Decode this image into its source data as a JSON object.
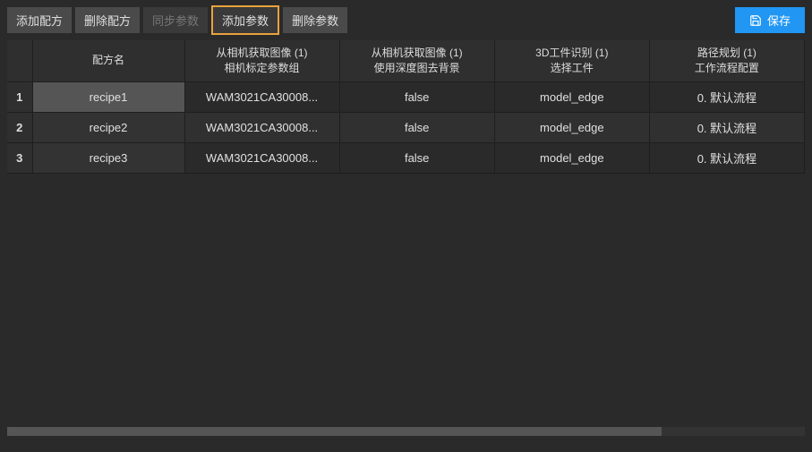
{
  "toolbar": {
    "add_recipe": "添加配方",
    "delete_recipe": "删除配方",
    "sync_params": "同步参数",
    "add_param": "添加参数",
    "delete_param": "删除参数",
    "save": "保存"
  },
  "table": {
    "headers": {
      "name": "配方名",
      "col1_line1": "从相机获取图像 (1)",
      "col1_line2": "相机标定参数组",
      "col2_line1": "从相机获取图像 (1)",
      "col2_line2": "使用深度图去背景",
      "col3_line1": "3D工件识别 (1)",
      "col3_line2": "选择工件",
      "col4_line1": "路径规划 (1)",
      "col4_line2": "工作流程配置"
    },
    "rows": [
      {
        "num": "1",
        "name": "recipe1",
        "c1": "WAM3021CA30008...",
        "c2": "false",
        "c3": "model_edge",
        "c4": "0. 默认流程"
      },
      {
        "num": "2",
        "name": "recipe2",
        "c1": "WAM3021CA30008...",
        "c2": "false",
        "c3": "model_edge",
        "c4": "0. 默认流程"
      },
      {
        "num": "3",
        "name": "recipe3",
        "c1": "WAM3021CA30008...",
        "c2": "false",
        "c3": "model_edge",
        "c4": "0. 默认流程"
      }
    ]
  }
}
